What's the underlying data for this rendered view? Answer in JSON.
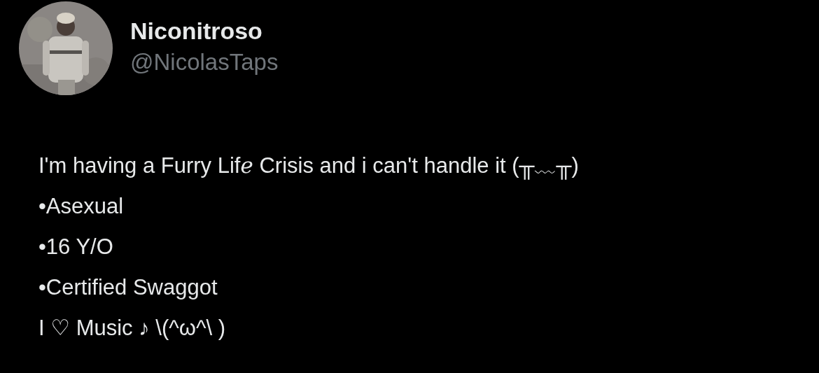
{
  "author": {
    "display_name": "Niconitroso",
    "handle": "@NicolasTaps"
  },
  "tweet": {
    "lines": [
      "I'm having a Furry Lifℯ Crisis and i can't handle it (╥﹏╥)",
      "•Asexual",
      "•16 Y/O",
      "•Certified Swaggot",
      "I ♡ Music ♪ \\(^ω^\\ )"
    ]
  }
}
